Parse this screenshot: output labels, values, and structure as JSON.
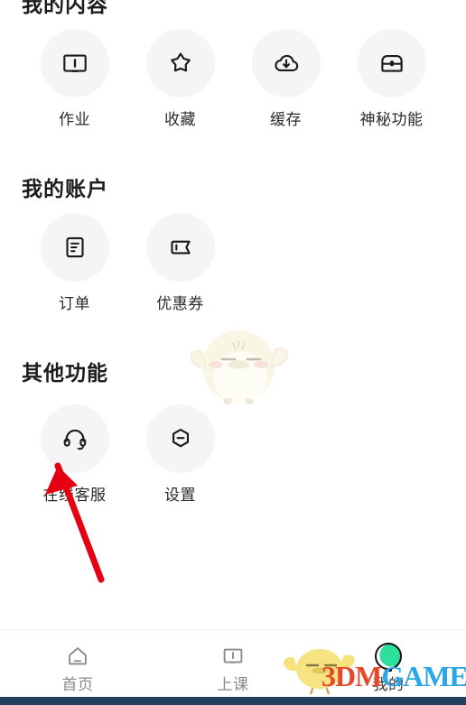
{
  "app": {
    "background_color": "#ffffff",
    "bubble_color": "#f5f5f5",
    "icon_color": "#1a1a1a",
    "accent_color": "#2ddf9b"
  },
  "sections": [
    {
      "title": "我的内容",
      "items": [
        {
          "label": "作业",
          "icon": "book-icon"
        },
        {
          "label": "收藏",
          "icon": "star-icon"
        },
        {
          "label": "缓存",
          "icon": "cloud-download-icon"
        },
        {
          "label": "神秘功能",
          "icon": "treasure-chest-icon"
        }
      ]
    },
    {
      "title": "我的账户",
      "items": [
        {
          "label": "订单",
          "icon": "order-document-icon"
        },
        {
          "label": "优惠券",
          "icon": "coupon-ticket-icon"
        }
      ]
    },
    {
      "title": "其他功能",
      "items": [
        {
          "label": "在线客服",
          "icon": "headset-icon"
        },
        {
          "label": "设置",
          "icon": "hexagon-settings-icon"
        }
      ]
    }
  ],
  "annotation": {
    "arrow_color": "#e60012",
    "points_to": "在线客服"
  },
  "tabbar": {
    "items": [
      {
        "label": "首页",
        "icon": "home-icon",
        "active": false
      },
      {
        "label": "上课",
        "icon": "open-book-icon",
        "active": false
      },
      {
        "label": "我的",
        "icon": "profile-avatar-icon",
        "active": true
      }
    ]
  },
  "watermark": {
    "text_primary": "3DM",
    "text_secondary": "GAME",
    "mascot": "chick-mascot"
  }
}
